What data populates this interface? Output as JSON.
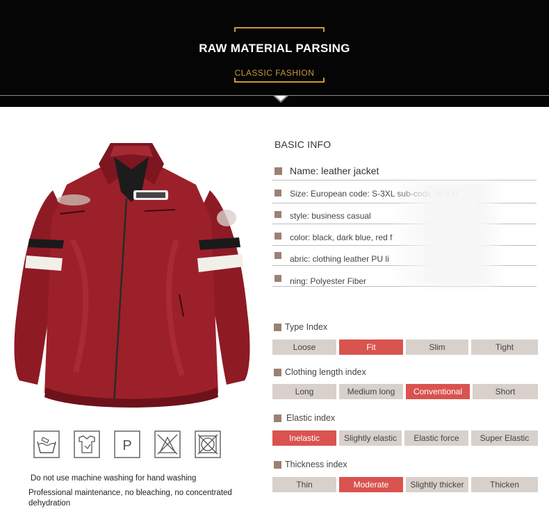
{
  "banner": {
    "title": "RAW MATERIAL PARSING",
    "subtitle": "CLASSIC FASHION"
  },
  "product_image": {
    "alt": "leather jacket",
    "colors": {
      "body": "#8e1a24",
      "highlight": "#b5303a",
      "shadow": "#5a0e15",
      "stripe_white": "#f2efe9",
      "stripe_black": "#1a1a1a"
    }
  },
  "care": {
    "icons": [
      "hand-wash-icon",
      "no-bleach-icon",
      "professional-dry-clean-icon",
      "do-not-tumble-dry-icon",
      "do-not-wring-icon"
    ],
    "note1": "Do not use machine washing for hand washing",
    "note2_line1": "Professional maintenance, no bleaching, no concentrated",
    "note2_line2": "dehydration"
  },
  "basic_info": {
    "heading": "BASIC INFO",
    "rows": [
      "Name: leather jacket",
      "Size: European code: S-3XL sub-code: M-4XL",
      "style: business casual",
      "color: black, dark blue, red f",
      "abric: clothing leather PU li",
      "ning: Polyester Fiber"
    ]
  },
  "indices": {
    "type": {
      "label": "Type Index",
      "options": [
        "Loose",
        "Fit",
        "Slim",
        "Tight"
      ],
      "selected": "Fit"
    },
    "length": {
      "label": "Clothing length index",
      "options": [
        "Long",
        "Medium long",
        "Conventional",
        "Short"
      ],
      "selected": "Conventional"
    },
    "elastic": {
      "label": "Elastic index",
      "options": [
        "Inelastic",
        "Slightly elastic",
        "Elastic force",
        "Super Elastic"
      ],
      "selected": "Inelastic"
    },
    "thickness": {
      "label": "Thickness index",
      "options": [
        "Thin",
        "Moderate",
        "Slightly thicker",
        "Thicken"
      ],
      "selected": "Moderate"
    }
  },
  "accent_color": "#d9534f",
  "inactive_color": "#d8d0cb",
  "marker_color": "#9b8173"
}
